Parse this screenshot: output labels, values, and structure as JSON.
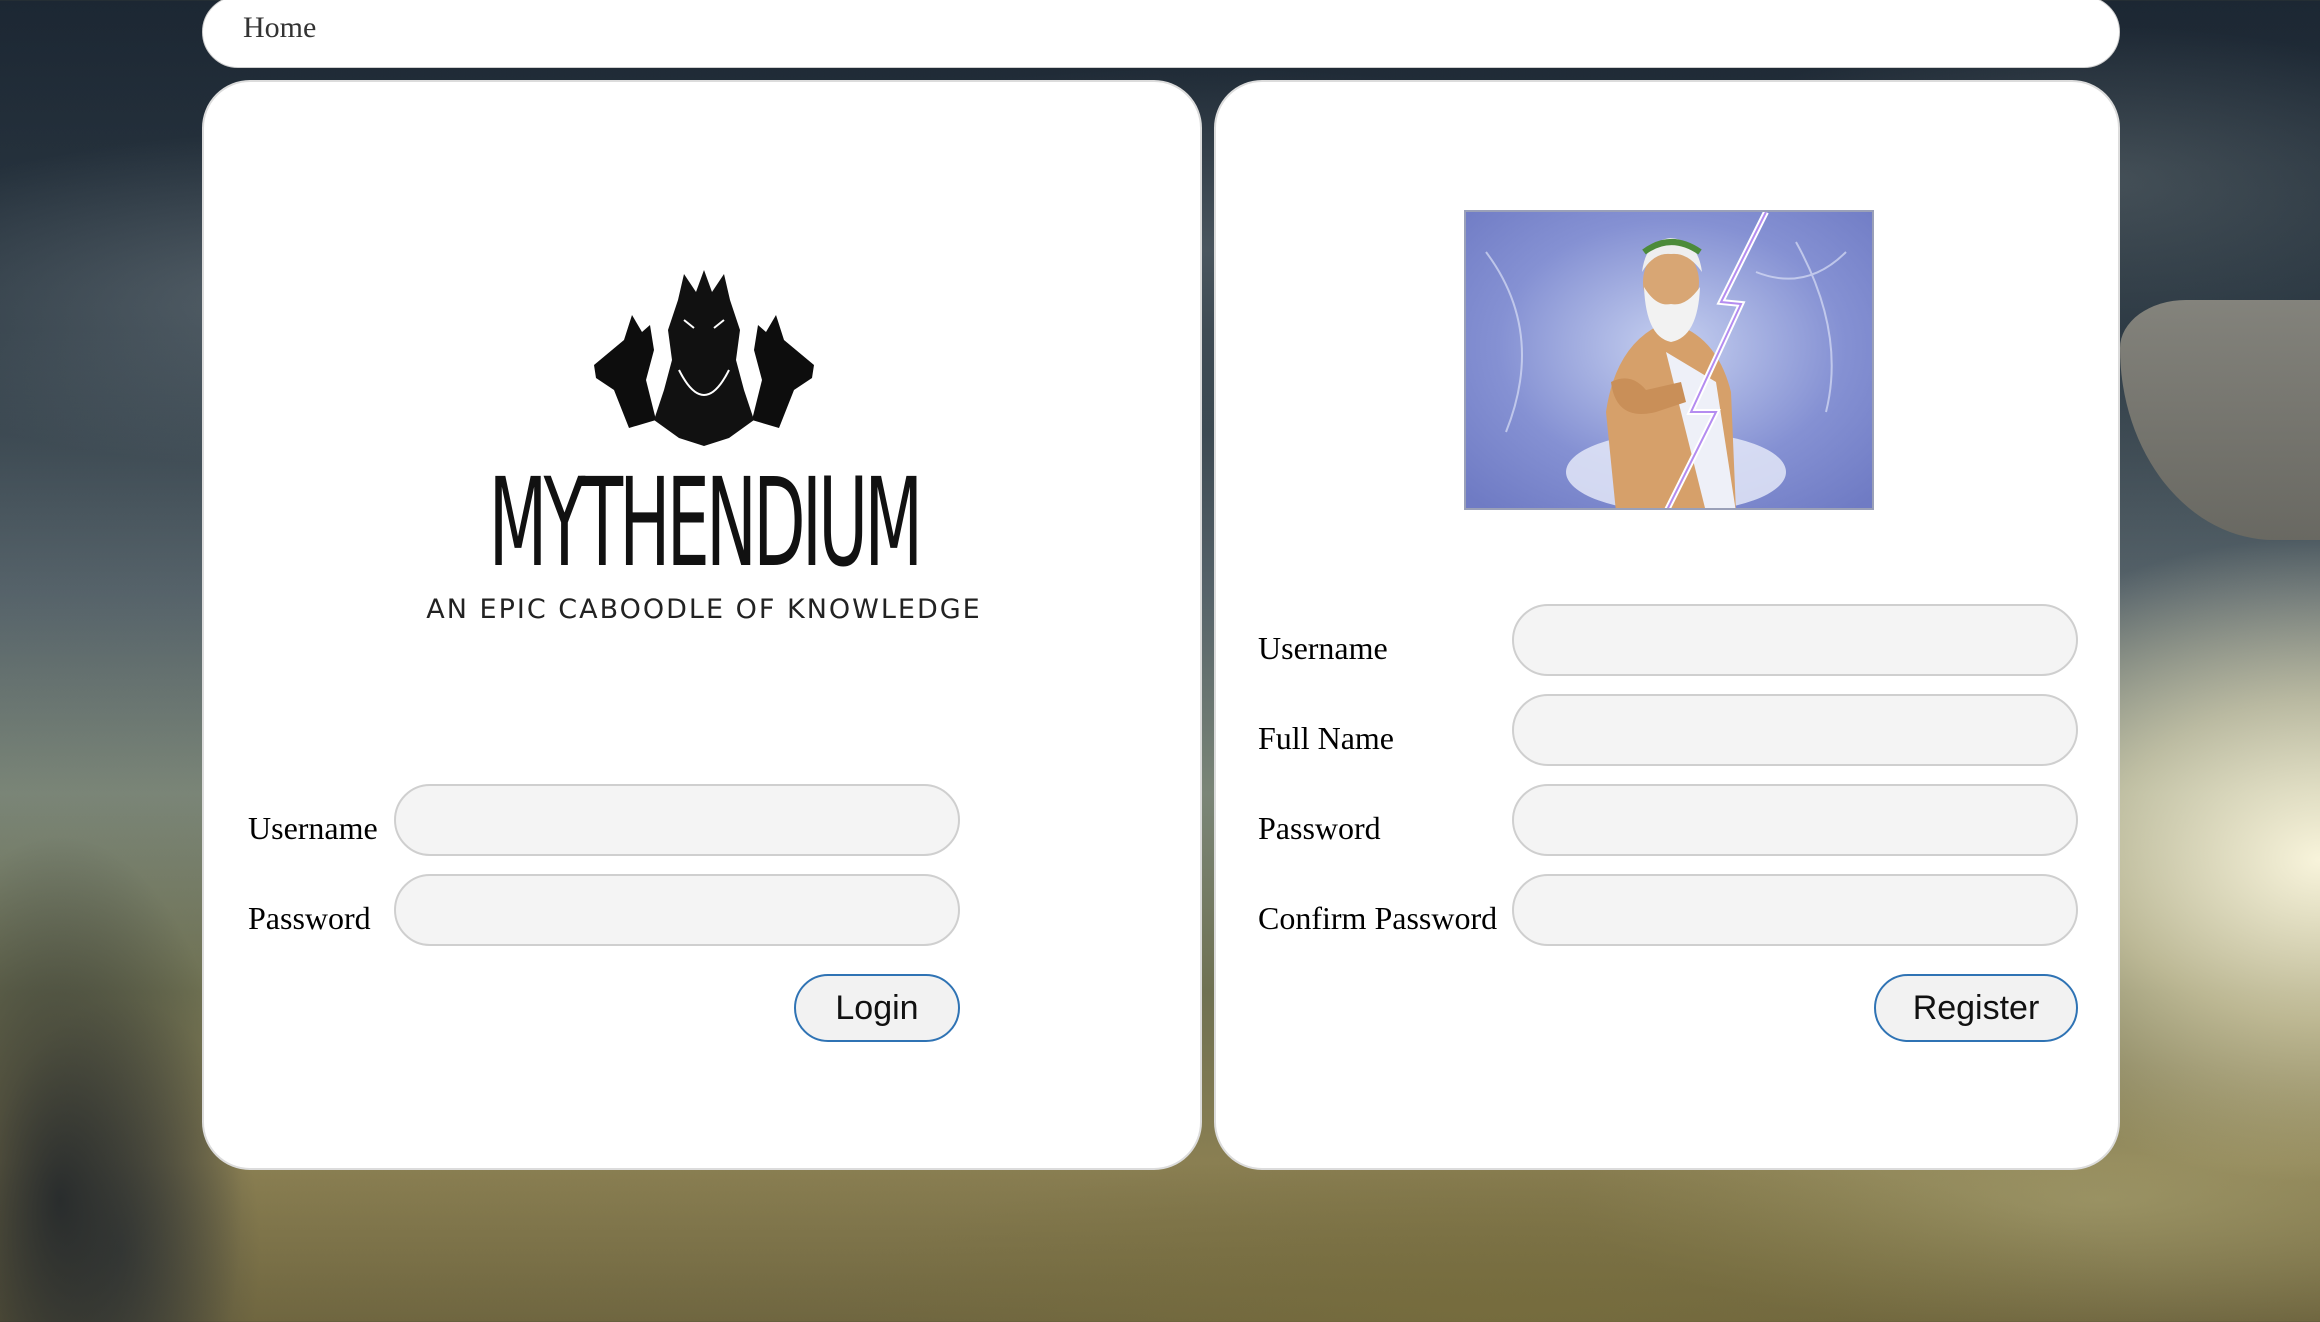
{
  "nav": {
    "home_label": "Home"
  },
  "logo": {
    "title": "MYTHENDIUM",
    "tagline": "AN EPIC CABOODLE OF KNOWLEDGE"
  },
  "login": {
    "username_label": "Username",
    "username_value": "",
    "password_label": "Password",
    "password_value": "",
    "submit_label": "Login"
  },
  "register": {
    "username_label": "Username",
    "username_value": "",
    "fullname_label": "Full Name",
    "fullname_value": "",
    "password_label": "Password",
    "password_value": "",
    "confirm_label": "Confirm Password",
    "confirm_value": "",
    "submit_label": "Register"
  },
  "colors": {
    "button_border": "#2f73b4",
    "input_bg": "#f4f4f4",
    "card_bg": "#ffffff"
  }
}
